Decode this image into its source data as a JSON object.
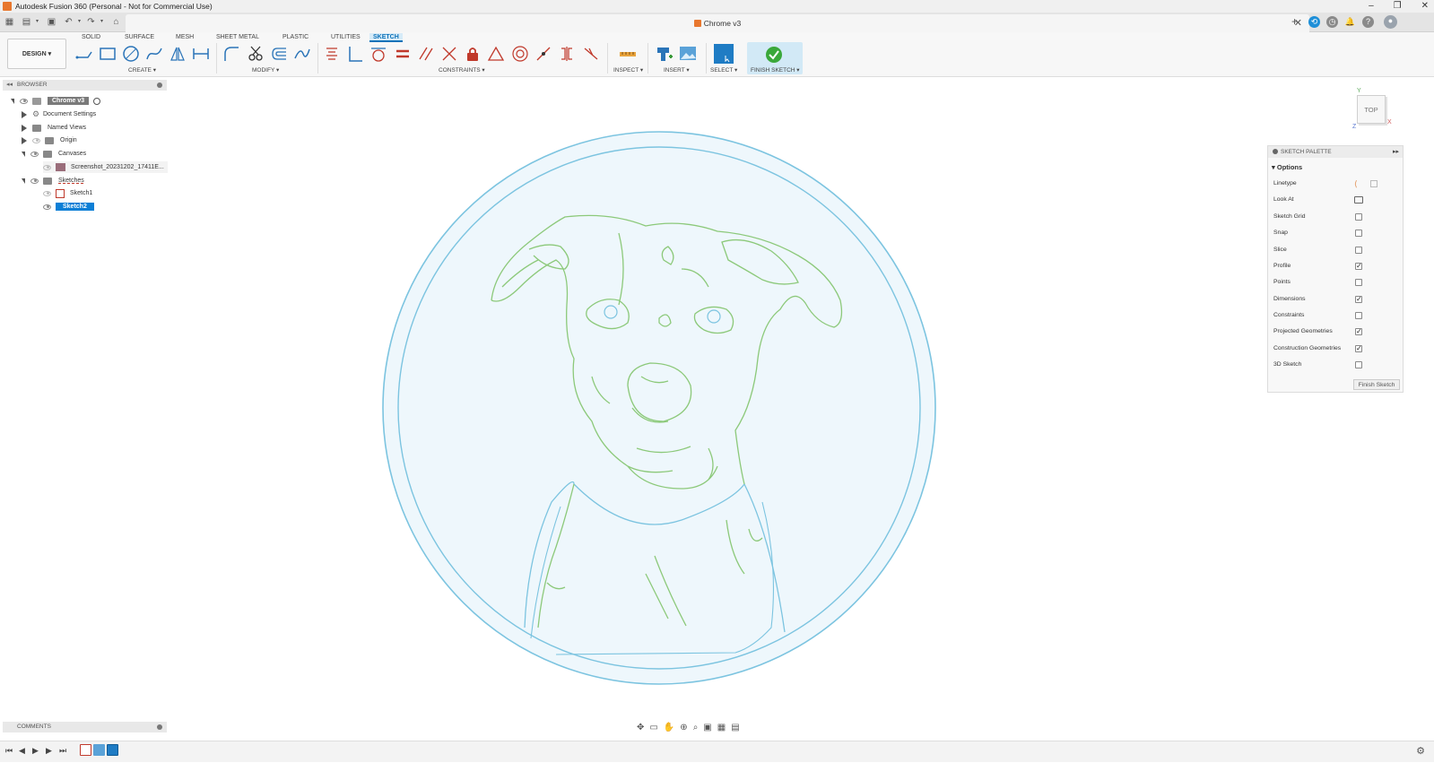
{
  "window": {
    "title": "Autodesk Fusion 360 (Personal - Not for Commercial Use)",
    "controls": [
      "–",
      "❐",
      "✕"
    ]
  },
  "document_tab": {
    "title": "Chrome v3",
    "close": "✕"
  },
  "workspace": {
    "label": "DESIGN ▾"
  },
  "ribbon_tabs": [
    "SOLID",
    "SURFACE",
    "MESH",
    "SHEET METAL",
    "PLASTIC",
    "UTILITIES",
    "SKETCH"
  ],
  "active_tab": "SKETCH",
  "ribbon_groups": {
    "create": "CREATE ▾",
    "modify": "MODIFY ▾",
    "constraints": "CONSTRAINTS ▾",
    "inspect": "INSPECT ▾",
    "insert": "INSERT ▾",
    "select": "SELECT ▾",
    "finish": "FINISH SKETCH ▾"
  },
  "browser": {
    "title": "BROWSER",
    "items": [
      {
        "label": "Chrome v3"
      },
      {
        "label": "Document Settings"
      },
      {
        "label": "Named Views"
      },
      {
        "label": "Origin"
      },
      {
        "label": "Canvases"
      },
      {
        "label": "Screenshot_20231202_17411E..."
      },
      {
        "label": "Sketches"
      },
      {
        "label": "Sketch1"
      },
      {
        "label": "Sketch2"
      }
    ]
  },
  "comments": {
    "title": "COMMENTS"
  },
  "viewcube": {
    "face": "TOP",
    "axis_x": "X",
    "axis_y": "Y",
    "axis_z": "Z"
  },
  "sketch_palette": {
    "title": "SKETCH PALETTE",
    "section": "Options",
    "rows": [
      {
        "label": "Linetype",
        "checked": null
      },
      {
        "label": "Look At",
        "checked": null
      },
      {
        "label": "Sketch Grid",
        "checked": false
      },
      {
        "label": "Snap",
        "checked": false
      },
      {
        "label": "Slice",
        "checked": false
      },
      {
        "label": "Profile",
        "checked": true
      },
      {
        "label": "Points",
        "checked": false
      },
      {
        "label": "Dimensions",
        "checked": true
      },
      {
        "label": "Constraints",
        "checked": false
      },
      {
        "label": "Projected Geometries",
        "checked": true
      },
      {
        "label": "Construction Geometries",
        "checked": true
      },
      {
        "label": "3D Sketch",
        "checked": false
      }
    ],
    "finish_button": "Finish Sketch"
  },
  "colors": {
    "accent": "#0d72b9",
    "sketch_green": "#8cc97a",
    "sketch_blue": "#7cc4e0",
    "circle_fill": "#eef7fc"
  }
}
